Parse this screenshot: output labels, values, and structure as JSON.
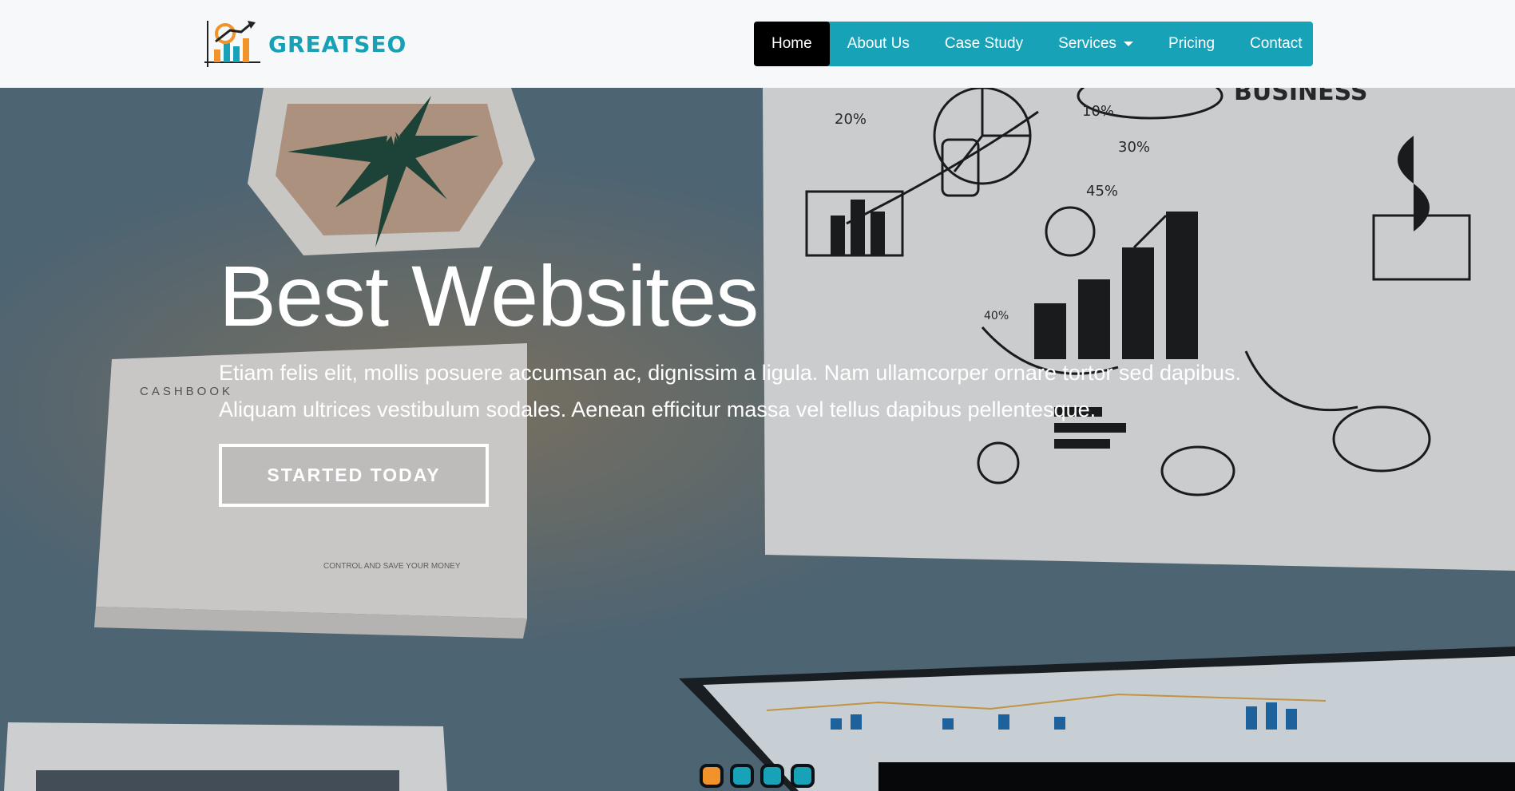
{
  "brand": {
    "name": "GREATSEO",
    "accent_color": "#17a2b8",
    "logo_icon": "growth-chart-icon"
  },
  "nav": {
    "items": [
      {
        "label": "Home",
        "active": true
      },
      {
        "label": "About Us",
        "active": false
      },
      {
        "label": "Case Study",
        "active": false
      },
      {
        "label": "Services",
        "active": false,
        "has_dropdown": true
      },
      {
        "label": "Pricing",
        "active": false
      },
      {
        "label": "Contact",
        "active": false
      }
    ]
  },
  "hero": {
    "title": "Best Websites",
    "text": "Etiam felis elit, mollis posuere accumsan ac, dignissim a ligula. Nam ullamcorper ornare tortor sed dapibus. Aliquam ultrices vestibulum sodales. Aenean efficitur massa vel tellus dapibus pellentesque.",
    "cta_label": "STARTED TODAY",
    "background_labels": {
      "cashbook": "CASHBOOK",
      "cashbook_sub": "CONTROL AND SAVE YOUR MONEY",
      "whiteboard_pcts": [
        "20%",
        "10%",
        "30%",
        "45%",
        "40%"
      ],
      "whiteboard_word": "BUSINESS"
    }
  },
  "carousel": {
    "slide_count": 4,
    "active_index": 0,
    "active_color": "#f2922b"
  }
}
